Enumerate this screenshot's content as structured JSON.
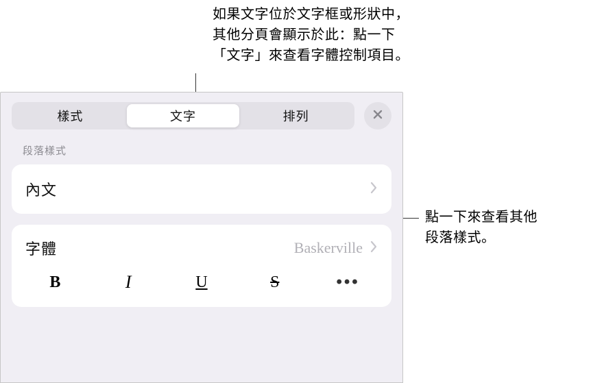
{
  "callouts": {
    "top": "如果文字位於文字框或形狀中，\n其他分頁會顯示於此：點一下\n「文字」來查看字體控制項目。",
    "right": "點一下來查看其他\n段落樣式。"
  },
  "tabs": {
    "style": "樣式",
    "text": "文字",
    "arrange": "排列"
  },
  "section": {
    "paragraphStyleLabel": "段落樣式"
  },
  "paragraphStyle": {
    "current": "內文"
  },
  "font": {
    "label": "字體",
    "value": "Baskerville"
  },
  "styleButtons": {
    "bold": "B",
    "italic": "I",
    "underline": "U",
    "strike": "S",
    "more": "•••"
  }
}
